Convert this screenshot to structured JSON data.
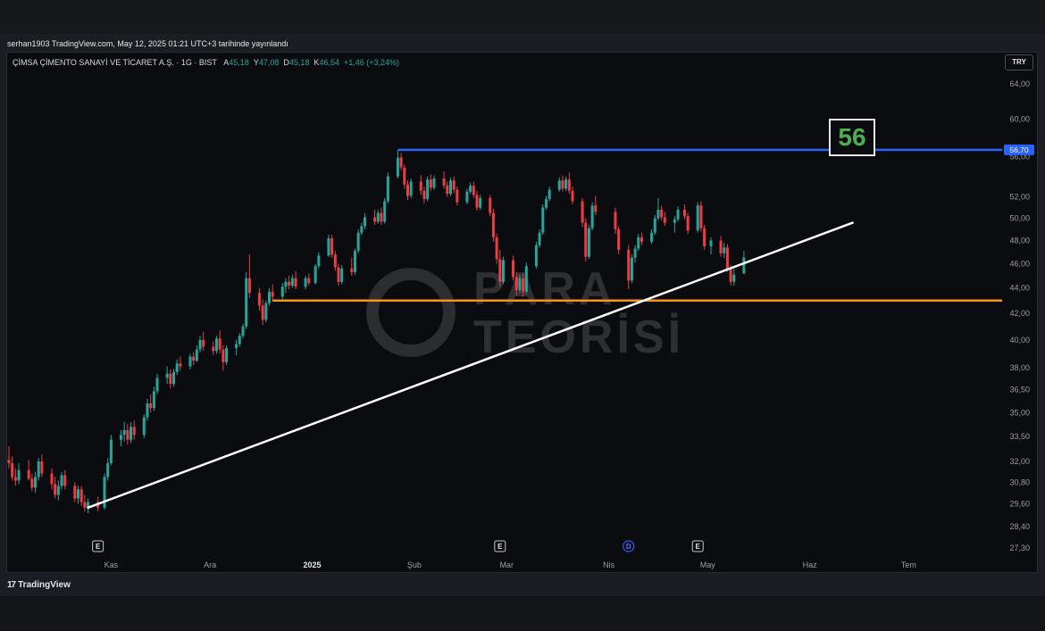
{
  "header": {
    "published": "serhan1903 TradingView.com, May 12, 2025 01:21 UTC+3 tarihinde yayınlandı"
  },
  "legend": {
    "symbol": "ÇİMSA ÇİMENTO SANAYİ VE TİCARET A.Ş. · 1G · BIST",
    "open_label": "A",
    "open": "45,18",
    "high_label": "Y",
    "high": "47,08",
    "low_label": "D",
    "low": "45,18",
    "close_label": "K",
    "close": "46,54",
    "change": "+1,46 (+3,24%)"
  },
  "currency": "TRY",
  "target_label": "56",
  "watermark": {
    "line1": "PARA",
    "line2": "TEORİSİ",
    "icon": "para-teorisi-logo-icon"
  },
  "footer": {
    "brand": "TradingView",
    "icon": "tradingview-logo-icon"
  },
  "colors": {
    "up": "#26a69a",
    "down": "#ef3b44",
    "resistance": "#2962ff",
    "support": "#f7931a",
    "trendline": "#ffffff",
    "target": "#4caf50"
  },
  "chart_data": {
    "type": "candlestick",
    "y_scale": "log",
    "ylim": [
      27.3,
      64.0
    ],
    "y_ticks": [
      "64,00",
      "60,00",
      "56,00",
      "52,00",
      "50,00",
      "48,00",
      "46,00",
      "44,00",
      "42,00",
      "40,00",
      "38,00",
      "36,50",
      "35,00",
      "33,50",
      "32,00",
      "30,80",
      "29,60",
      "28,40",
      "27,30"
    ],
    "y_tick_values": [
      64.0,
      60.0,
      56.0,
      52.0,
      50.0,
      48.0,
      46.0,
      44.0,
      42.0,
      40.0,
      38.0,
      36.5,
      35.0,
      33.5,
      32.0,
      30.8,
      29.6,
      28.4,
      27.3
    ],
    "x_ticks": [
      "Kas",
      "Ara",
      "2025",
      "Şub",
      "Mar",
      "Nis",
      "May",
      "Haz",
      "Tem"
    ],
    "price_label": "56,70",
    "resistance": {
      "value": 56.7,
      "start_date": "2025-01-27"
    },
    "support": {
      "value": 43.0,
      "start_date": "2024-12-20"
    },
    "trendline": {
      "start": [
        "2024-10-25",
        29.4
      ],
      "end": [
        "2025-06-14",
        49.6
      ]
    },
    "event_markers": [
      {
        "label": "E",
        "date": "2024-10-28"
      },
      {
        "label": "E",
        "date": "2025-02-27"
      },
      {
        "label": "D",
        "date": "2025-04-07"
      },
      {
        "label": "E",
        "date": "2025-04-28"
      }
    ],
    "candles": [
      [
        "2024-10-01",
        32.1,
        32.9,
        31.6,
        31.9
      ],
      [
        "2024-10-02",
        31.9,
        32.3,
        30.9,
        31.1
      ],
      [
        "2024-10-03",
        31.1,
        31.6,
        30.6,
        30.9
      ],
      [
        "2024-10-04",
        30.9,
        31.9,
        30.7,
        31.5
      ],
      [
        "2024-10-07",
        31.5,
        32.1,
        30.9,
        31.0
      ],
      [
        "2024-10-08",
        31.0,
        31.3,
        30.3,
        30.5
      ],
      [
        "2024-10-09",
        30.5,
        31.4,
        30.2,
        31.1
      ],
      [
        "2024-10-10",
        31.1,
        32.2,
        30.9,
        32.0
      ],
      [
        "2024-10-11",
        32.0,
        32.4,
        31.1,
        31.3
      ],
      [
        "2024-10-14",
        31.3,
        31.6,
        30.4,
        30.7
      ],
      [
        "2024-10-15",
        30.7,
        31.1,
        29.9,
        30.1
      ],
      [
        "2024-10-16",
        30.1,
        30.9,
        29.8,
        30.6
      ],
      [
        "2024-10-17",
        30.6,
        31.4,
        30.4,
        31.2
      ],
      [
        "2024-10-18",
        31.2,
        31.5,
        30.4,
        30.6
      ],
      [
        "2024-10-21",
        30.6,
        30.8,
        29.7,
        29.9
      ],
      [
        "2024-10-22",
        29.9,
        30.6,
        29.6,
        30.4
      ],
      [
        "2024-10-23",
        30.4,
        30.6,
        29.5,
        29.7
      ],
      [
        "2024-10-24",
        29.7,
        30.1,
        29.2,
        29.4
      ],
      [
        "2024-10-25",
        29.4,
        29.9,
        29.1,
        29.7
      ],
      [
        "2024-10-28",
        29.7,
        30.0,
        29.2,
        29.4
      ],
      [
        "2024-10-30",
        29.4,
        31.3,
        29.3,
        31.1
      ],
      [
        "2024-10-31",
        31.1,
        32.2,
        30.9,
        31.9
      ],
      [
        "2024-11-01",
        31.9,
        33.6,
        31.8,
        33.3
      ],
      [
        "2024-11-04",
        33.3,
        33.9,
        32.9,
        33.6
      ],
      [
        "2024-11-05",
        33.6,
        34.4,
        33.2,
        33.9
      ],
      [
        "2024-11-06",
        33.9,
        34.3,
        33.0,
        33.3
      ],
      [
        "2024-11-07",
        33.3,
        34.4,
        33.1,
        34.1
      ],
      [
        "2024-11-08",
        34.1,
        34.5,
        33.3,
        33.6
      ],
      [
        "2024-11-11",
        33.6,
        34.9,
        33.4,
        34.7
      ],
      [
        "2024-11-12",
        34.7,
        35.9,
        34.5,
        35.6
      ],
      [
        "2024-11-13",
        35.6,
        36.2,
        35.0,
        35.3
      ],
      [
        "2024-11-14",
        35.3,
        36.7,
        35.1,
        36.4
      ],
      [
        "2024-11-15",
        36.4,
        37.6,
        36.2,
        37.3
      ],
      [
        "2024-11-18",
        37.3,
        38.1,
        36.9,
        37.6
      ],
      [
        "2024-11-19",
        37.6,
        37.9,
        36.6,
        36.9
      ],
      [
        "2024-11-20",
        36.9,
        37.9,
        36.7,
        37.7
      ],
      [
        "2024-11-21",
        37.7,
        38.6,
        37.5,
        38.3
      ],
      [
        "2024-11-22",
        38.3,
        38.8,
        37.8,
        38.1
      ],
      [
        "2024-11-25",
        38.1,
        39.0,
        37.9,
        38.8
      ],
      [
        "2024-11-26",
        38.8,
        39.1,
        38.2,
        38.5
      ],
      [
        "2024-11-27",
        38.5,
        39.6,
        38.4,
        39.3
      ],
      [
        "2024-11-28",
        39.3,
        40.3,
        39.1,
        40.0
      ],
      [
        "2024-11-29",
        40.0,
        40.6,
        39.2,
        39.5
      ],
      [
        "2024-12-02",
        39.5,
        39.9,
        38.9,
        39.2
      ],
      [
        "2024-12-03",
        39.2,
        40.3,
        39.0,
        40.1
      ],
      [
        "2024-12-04",
        40.1,
        40.7,
        39.0,
        39.3
      ],
      [
        "2024-12-05",
        39.3,
        39.6,
        37.8,
        38.4
      ],
      [
        "2024-12-06",
        38.4,
        39.6,
        38.2,
        39.4
      ],
      [
        "2024-12-09",
        39.4,
        40.0,
        38.9,
        39.7
      ],
      [
        "2024-12-10",
        39.7,
        40.5,
        39.5,
        40.3
      ],
      [
        "2024-12-11",
        40.3,
        41.2,
        40.1,
        41.0
      ],
      [
        "2024-12-12",
        41.0,
        45.3,
        40.8,
        44.8
      ],
      [
        "2024-12-13",
        44.8,
        46.8,
        43.2,
        43.6
      ],
      [
        "2024-12-16",
        43.6,
        44.0,
        42.2,
        42.6
      ],
      [
        "2024-12-17",
        42.6,
        43.1,
        41.1,
        41.5
      ],
      [
        "2024-12-18",
        41.5,
        43.0,
        41.3,
        42.8
      ],
      [
        "2024-12-19",
        42.8,
        44.0,
        42.6,
        43.7
      ],
      [
        "2024-12-20",
        43.7,
        44.3,
        42.9,
        43.3
      ],
      [
        "2024-12-23",
        43.3,
        44.4,
        43.1,
        44.1
      ],
      [
        "2024-12-24",
        44.1,
        44.8,
        43.6,
        44.5
      ],
      [
        "2024-12-25",
        44.5,
        45.0,
        43.9,
        44.2
      ],
      [
        "2024-12-26",
        44.2,
        45.1,
        44.0,
        44.8
      ],
      [
        "2024-12-27",
        44.8,
        45.4,
        43.9,
        44.1
      ],
      [
        "2024-12-30",
        44.1,
        45.0,
        43.9,
        44.8
      ],
      [
        "2024-12-31",
        44.8,
        45.2,
        44.2,
        44.4
      ],
      [
        "2025-01-02",
        44.4,
        46.0,
        44.3,
        45.8
      ],
      [
        "2025-01-03",
        45.8,
        47.0,
        45.6,
        46.7
      ],
      [
        "2025-01-06",
        46.7,
        48.5,
        46.6,
        48.2
      ],
      [
        "2025-01-07",
        48.2,
        48.5,
        46.5,
        46.8
      ],
      [
        "2025-01-08",
        46.8,
        47.1,
        45.4,
        45.7
      ],
      [
        "2025-01-09",
        45.7,
        46.0,
        44.2,
        44.5
      ],
      [
        "2025-01-10",
        44.5,
        45.9,
        44.3,
        45.6
      ],
      [
        "2025-01-13",
        45.6,
        46.5,
        45.0,
        45.3
      ],
      [
        "2025-01-14",
        45.3,
        47.3,
        45.1,
        47.1
      ],
      [
        "2025-01-15",
        47.1,
        49.0,
        46.9,
        48.7
      ],
      [
        "2025-01-16",
        48.7,
        49.6,
        48.5,
        49.3
      ],
      [
        "2025-01-17",
        49.3,
        50.5,
        49.0,
        50.1
      ],
      [
        "2025-01-20",
        50.1,
        50.8,
        49.4,
        49.7
      ],
      [
        "2025-01-21",
        49.7,
        50.8,
        49.5,
        50.5
      ],
      [
        "2025-01-22",
        50.5,
        51.0,
        49.4,
        49.7
      ],
      [
        "2025-01-23",
        49.7,
        51.9,
        49.5,
        51.6
      ],
      [
        "2025-01-24",
        51.6,
        54.4,
        51.4,
        54.0
      ],
      [
        "2025-01-27",
        54.0,
        56.7,
        53.8,
        55.9
      ],
      [
        "2025-01-28",
        55.9,
        56.4,
        54.6,
        54.9
      ],
      [
        "2025-01-29",
        54.9,
        55.2,
        52.8,
        53.2
      ],
      [
        "2025-01-30",
        53.2,
        53.6,
        51.7,
        52.1
      ],
      [
        "2025-01-31",
        52.1,
        53.8,
        51.9,
        53.5
      ],
      [
        "2025-02-03",
        53.5,
        54.1,
        52.2,
        52.6
      ],
      [
        "2025-02-04",
        52.6,
        53.0,
        51.4,
        51.8
      ],
      [
        "2025-02-05",
        51.8,
        54.0,
        51.6,
        53.7
      ],
      [
        "2025-02-06",
        53.7,
        54.2,
        52.6,
        52.9
      ],
      [
        "2025-02-07",
        52.9,
        54.1,
        52.7,
        53.8
      ],
      [
        "2025-02-10",
        53.8,
        54.5,
        52.8,
        53.1
      ],
      [
        "2025-02-11",
        53.1,
        53.5,
        52.0,
        52.3
      ],
      [
        "2025-02-12",
        52.3,
        53.9,
        52.1,
        53.6
      ],
      [
        "2025-02-13",
        53.6,
        54.0,
        52.4,
        52.7
      ],
      [
        "2025-02-14",
        52.7,
        53.0,
        51.2,
        51.5
      ],
      [
        "2025-02-17",
        51.5,
        52.8,
        51.3,
        52.5
      ],
      [
        "2025-02-18",
        52.5,
        53.4,
        52.3,
        53.1
      ],
      [
        "2025-02-19",
        53.1,
        53.5,
        51.9,
        52.2
      ],
      [
        "2025-02-20",
        52.2,
        52.6,
        50.7,
        51.0
      ],
      [
        "2025-02-21",
        51.0,
        52.2,
        50.8,
        51.9
      ],
      [
        "2025-02-24",
        51.9,
        52.2,
        50.2,
        50.5
      ],
      [
        "2025-02-25",
        50.5,
        50.9,
        47.9,
        48.3
      ],
      [
        "2025-02-26",
        48.3,
        48.6,
        46.0,
        46.4
      ],
      [
        "2025-02-27",
        46.4,
        47.2,
        44.1,
        44.5
      ],
      [
        "2025-02-28",
        44.5,
        46.6,
        44.3,
        46.3
      ],
      [
        "2025-03-03",
        46.3,
        46.7,
        44.6,
        44.9
      ],
      [
        "2025-03-04",
        44.9,
        45.3,
        43.4,
        43.8
      ],
      [
        "2025-03-05",
        43.8,
        45.1,
        43.6,
        44.8
      ],
      [
        "2025-03-06",
        44.8,
        45.2,
        43.3,
        43.7
      ],
      [
        "2025-03-07",
        43.7,
        46.1,
        43.5,
        45.8
      ],
      [
        "2025-03-10",
        45.8,
        47.9,
        45.6,
        47.6
      ],
      [
        "2025-03-11",
        47.6,
        49.0,
        47.4,
        48.7
      ],
      [
        "2025-03-12",
        48.7,
        51.3,
        48.5,
        51.0
      ],
      [
        "2025-03-13",
        51.0,
        52.1,
        50.8,
        51.8
      ],
      [
        "2025-03-14",
        51.8,
        53.0,
        51.6,
        52.7
      ],
      [
        "2025-03-17",
        52.7,
        53.9,
        52.5,
        53.6
      ],
      [
        "2025-03-18",
        53.6,
        54.1,
        52.5,
        52.8
      ],
      [
        "2025-03-19",
        52.8,
        54.0,
        52.6,
        53.7
      ],
      [
        "2025-03-20",
        53.7,
        54.4,
        52.3,
        52.6
      ],
      [
        "2025-03-21",
        52.6,
        53.0,
        51.3,
        51.6
      ],
      [
        "2025-03-24",
        51.6,
        51.9,
        49.2,
        49.6
      ],
      [
        "2025-03-25",
        49.6,
        50.0,
        46.2,
        46.6
      ],
      [
        "2025-03-26",
        46.6,
        49.4,
        46.4,
        49.1
      ],
      [
        "2025-03-27",
        49.1,
        51.5,
        48.9,
        51.2
      ],
      [
        "2025-03-28",
        51.2,
        52.1,
        50.3,
        50.6
      ],
      [
        "2025-04-03",
        50.6,
        51.0,
        48.6,
        49.0
      ],
      [
        "2025-04-04",
        49.0,
        49.3,
        46.8,
        47.2
      ],
      [
        "2025-04-07",
        47.2,
        47.6,
        43.9,
        44.6
      ],
      [
        "2025-04-08",
        44.6,
        46.8,
        44.4,
        46.5
      ],
      [
        "2025-04-09",
        46.5,
        47.6,
        46.1,
        47.3
      ],
      [
        "2025-04-10",
        47.3,
        48.6,
        47.1,
        48.3
      ],
      [
        "2025-04-11",
        48.3,
        48.7,
        47.6,
        47.9
      ],
      [
        "2025-04-14",
        47.9,
        49.0,
        47.7,
        48.7
      ],
      [
        "2025-04-15",
        48.7,
        50.3,
        48.5,
        50.0
      ],
      [
        "2025-04-16",
        50.0,
        51.9,
        49.8,
        50.8
      ],
      [
        "2025-04-17",
        50.8,
        51.2,
        49.8,
        50.1
      ],
      [
        "2025-04-18",
        50.1,
        50.6,
        49.3,
        49.6
      ],
      [
        "2025-04-21",
        49.6,
        50.2,
        48.7,
        49.9
      ],
      [
        "2025-04-22",
        49.9,
        51.1,
        49.7,
        50.8
      ],
      [
        "2025-04-24",
        50.8,
        51.3,
        49.9,
        50.2
      ],
      [
        "2025-04-25",
        50.2,
        50.5,
        48.6,
        48.9
      ],
      [
        "2025-04-28",
        48.9,
        51.5,
        48.7,
        51.2
      ],
      [
        "2025-04-29",
        51.2,
        51.6,
        48.8,
        49.1
      ],
      [
        "2025-04-30",
        49.1,
        49.4,
        47.2,
        47.5
      ],
      [
        "2025-05-02",
        47.5,
        48.3,
        46.8,
        48.0
      ],
      [
        "2025-05-05",
        48.0,
        48.4,
        46.6,
        46.9
      ],
      [
        "2025-05-06",
        46.9,
        47.8,
        46.5,
        47.4
      ],
      [
        "2025-05-07",
        47.4,
        47.7,
        45.3,
        45.6
      ],
      [
        "2025-05-08",
        45.6,
        45.9,
        44.2,
        44.5
      ],
      [
        "2025-05-09",
        44.5,
        45.6,
        44.2,
        45.1
      ],
      [
        "2025-05-12",
        45.18,
        47.08,
        45.18,
        46.54
      ]
    ]
  }
}
